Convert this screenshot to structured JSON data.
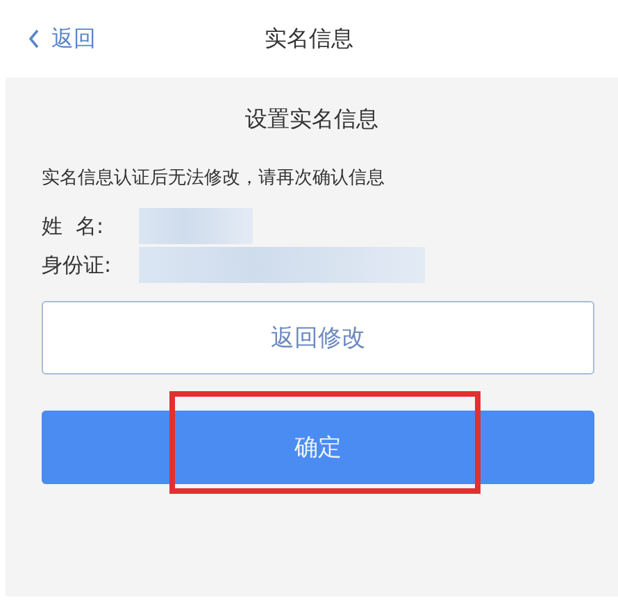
{
  "nav": {
    "back": "返回",
    "title": "实名信息"
  },
  "panel": {
    "heading": "设置实名信息",
    "notice": "实名信息认证后无法修改，请再次确认信息",
    "fields": [
      {
        "label": "姓  名:",
        "redacted": true
      },
      {
        "label": "身份证:",
        "redacted": true
      }
    ]
  },
  "buttons": [
    {
      "label": "返回修改",
      "kind": "outline",
      "highlighted": false
    },
    {
      "label": "确定",
      "kind": "primary",
      "highlighted": true
    }
  ]
}
